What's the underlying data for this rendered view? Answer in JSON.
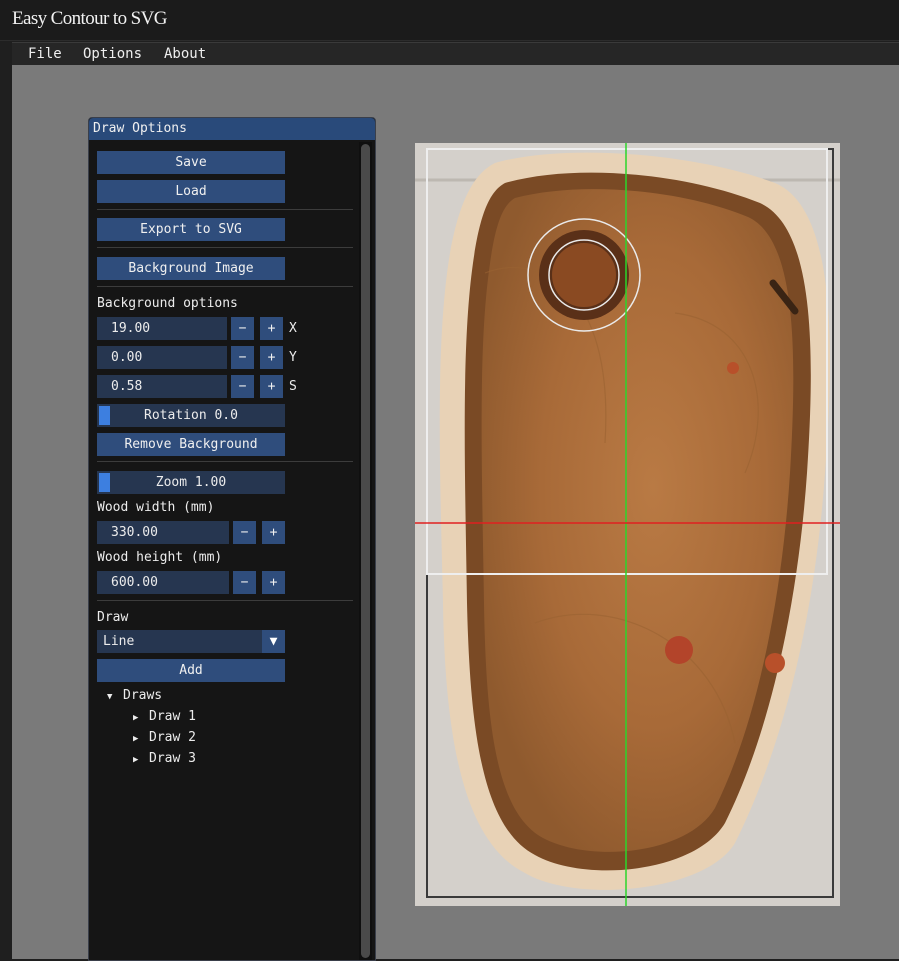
{
  "window": {
    "title": "Easy Contour to SVG"
  },
  "menu": {
    "file": "File",
    "options": "Options",
    "about": "About"
  },
  "panel": {
    "title": "Draw Options",
    "save": "Save",
    "load": "Load",
    "export": "Export to SVG",
    "background_image": "Background Image",
    "background_options_label": "Background options",
    "bg_x": {
      "value": "19.00",
      "axis": "X"
    },
    "bg_y": {
      "value": "0.00",
      "axis": "Y"
    },
    "bg_s": {
      "value": "0.58",
      "axis": "S"
    },
    "rotation": "Rotation 0.0",
    "remove_background": "Remove Background",
    "zoom": "Zoom 1.00",
    "wood_width_label": "Wood width (mm)",
    "wood_width": "330.00",
    "wood_height_label": "Wood height (mm)",
    "wood_height": "600.00",
    "draw_label": "Draw",
    "draw_type": "Line",
    "add": "Add",
    "draws_root": "Draws",
    "draws": [
      "Draw 1",
      "Draw 2",
      "Draw 3"
    ]
  },
  "controls": {
    "minus": "−",
    "plus": "+",
    "dropdown_arrow": "▼",
    "tree_open": "▼",
    "tree_closed": "▶"
  },
  "colors": {
    "title_bar": "#1b1b1b",
    "panel_header": "#294a7a",
    "button": "#2f4d7c",
    "field": "#263650",
    "guide_vertical": "#2bd62b",
    "guide_horizontal": "#e02020"
  }
}
